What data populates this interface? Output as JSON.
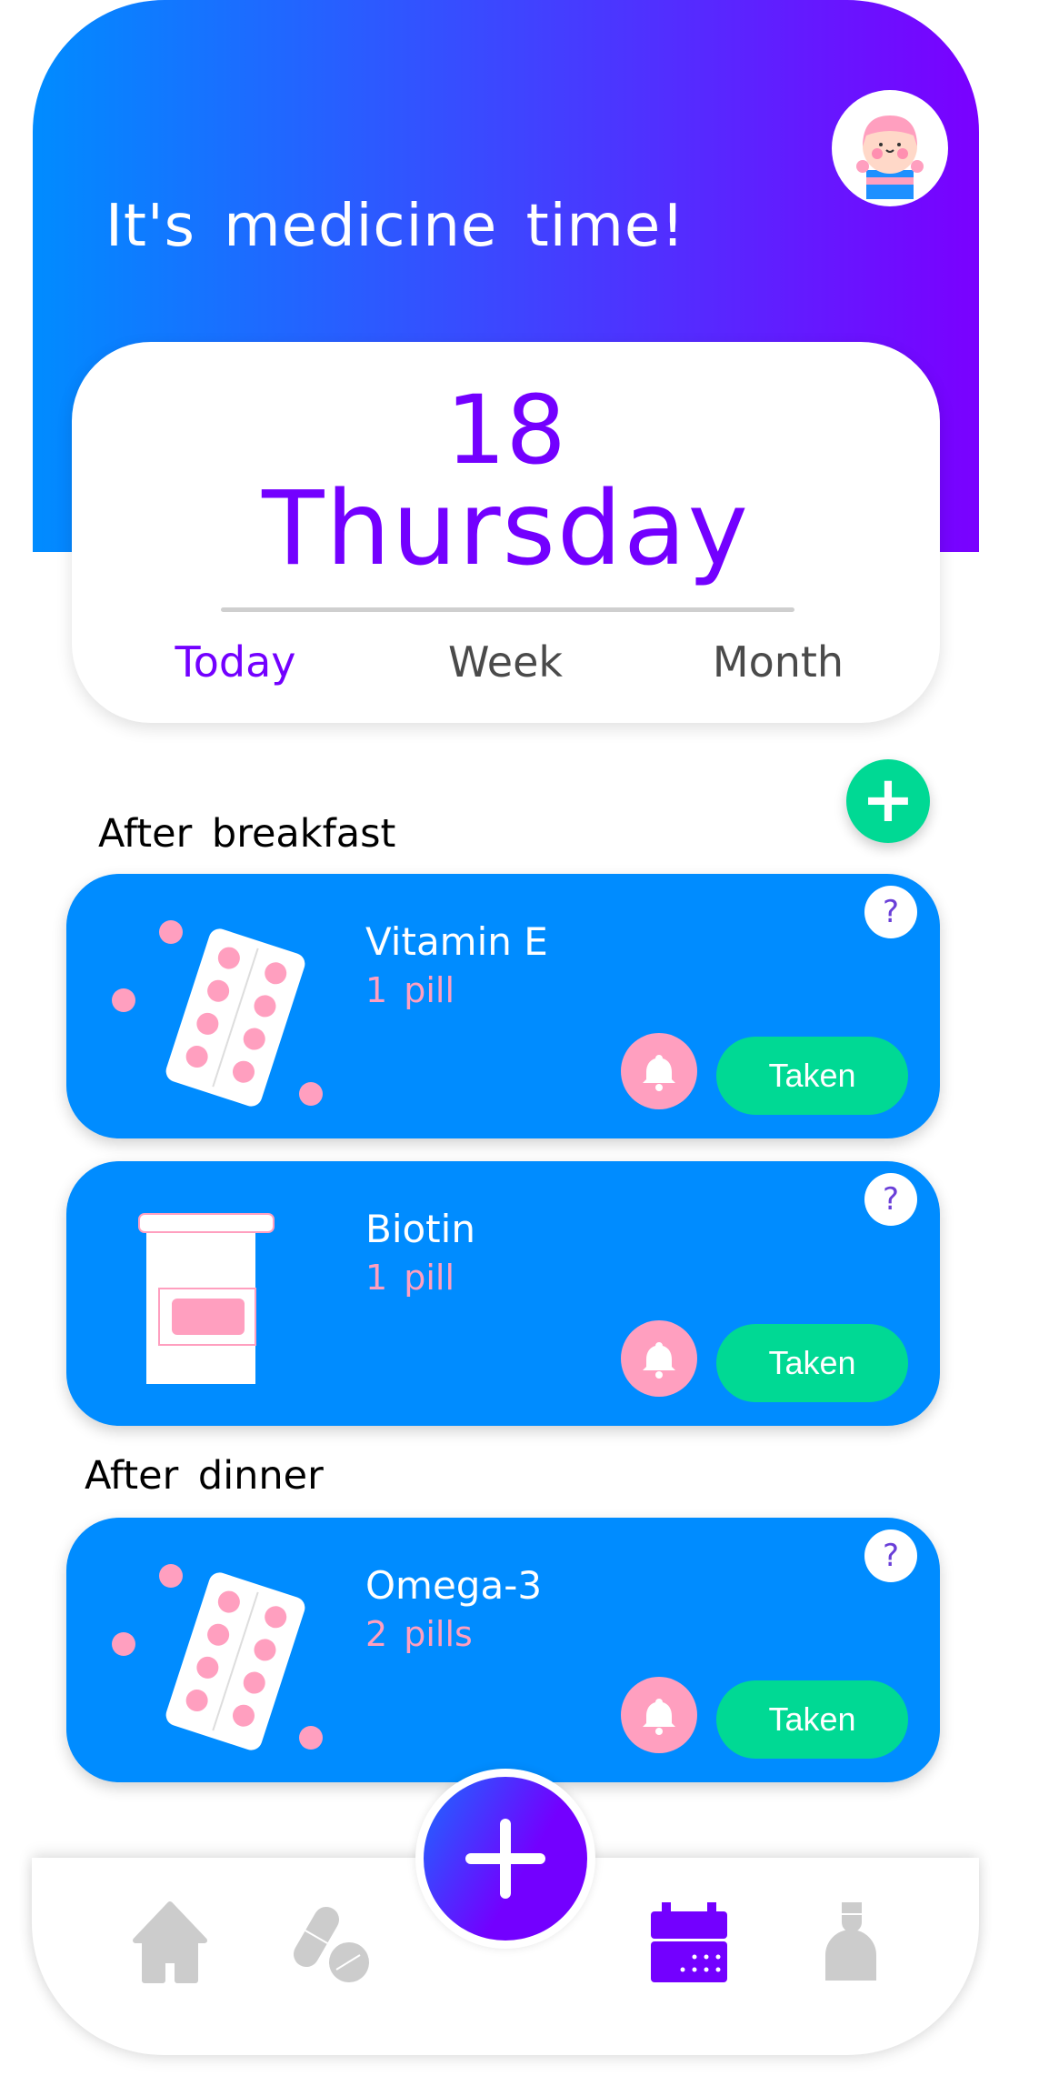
{
  "header": {
    "title": "It's medicine time!",
    "avatar": "girl-avatar"
  },
  "date": {
    "day": "18",
    "weekday": "Thursday",
    "tabs": [
      {
        "label": "Today",
        "active": true
      },
      {
        "label": "Week",
        "active": false
      },
      {
        "label": "Month",
        "active": false
      }
    ]
  },
  "add_label": "+",
  "sections": [
    {
      "title": "After breakfast",
      "items": [
        {
          "name": "Vitamin E",
          "qty": "1 pill",
          "icon": "blister-pack",
          "action": "Taken",
          "help": "?"
        },
        {
          "name": "Biotin",
          "qty": "1 pill",
          "icon": "pill-bottle",
          "action": "Taken",
          "help": "?"
        }
      ]
    },
    {
      "title": "After dinner",
      "items": [
        {
          "name": "Omega-3",
          "qty": "2 pills",
          "icon": "blister-pack",
          "action": "Taken",
          "help": "?"
        }
      ]
    }
  ],
  "nav": {
    "items": [
      "home-icon",
      "pills-icon",
      "calendar-icon",
      "doctor-icon"
    ],
    "active": "calendar-icon"
  },
  "colors": {
    "blue": "#008cff",
    "purple": "#7300ff",
    "green": "#00d994",
    "pink": "#ff9fbf"
  }
}
